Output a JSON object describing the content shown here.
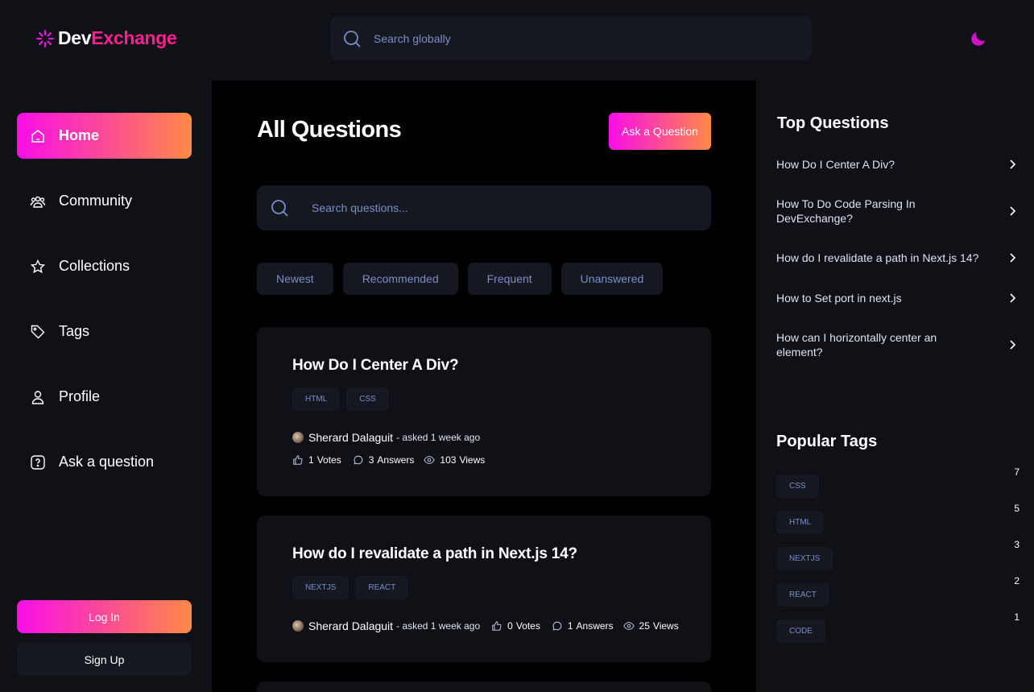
{
  "brand": {
    "part1": "Dev",
    "part2": "Exchange",
    "accent": "#ff1f8e"
  },
  "header": {
    "search_placeholder": "Search globally",
    "theme_icon": "moon-icon"
  },
  "sidebar": {
    "items": [
      {
        "label": "Home",
        "icon": "home-icon",
        "active": true
      },
      {
        "label": "Community",
        "icon": "users-icon",
        "active": false
      },
      {
        "label": "Collections",
        "icon": "star-icon",
        "active": false
      },
      {
        "label": "Tags",
        "icon": "tag-icon",
        "active": false
      },
      {
        "label": "Profile",
        "icon": "user-icon",
        "active": false
      },
      {
        "label": "Ask a question",
        "icon": "question-icon",
        "active": false
      }
    ],
    "login_label": "Log In",
    "signup_label": "Sign Up"
  },
  "main": {
    "title": "All Questions",
    "ask_button": "Ask a Question",
    "search_placeholder": "Search questions...",
    "filters": [
      "Newest",
      "Recommended",
      "Frequent",
      "Unanswered"
    ],
    "questions": [
      {
        "title": "How Do I Center A Div?",
        "tags": [
          "HTML",
          "CSS"
        ],
        "author": "Sherard Dalaguit",
        "asked": "- asked 1 week ago",
        "votes": "1",
        "votes_label": "Votes",
        "answers": "3",
        "answers_label": "Answers",
        "views": "103",
        "views_label": "Views"
      },
      {
        "title": "How do I revalidate a path in Next.js 14?",
        "tags": [
          "NEXTJS",
          "REACT"
        ],
        "author": "Sherard Dalaguit",
        "asked": "- asked 1 week ago",
        "votes": "0",
        "votes_label": "Votes",
        "answers": "1",
        "answers_label": "Answers",
        "views": "25",
        "views_label": "Views"
      }
    ]
  },
  "right": {
    "top_title": "Top Questions",
    "top_questions": [
      "How Do I Center A Div?",
      "How To Do Code Parsing In DevExchange?",
      "How do I revalidate a path in Next.js 14?",
      "How to Set port in next.js",
      "How can I horizontally center an element?"
    ],
    "tags_title": "Popular Tags",
    "popular_tags": [
      {
        "name": "CSS",
        "count": "7"
      },
      {
        "name": "HTML",
        "count": "5"
      },
      {
        "name": "NEXTJS",
        "count": "3"
      },
      {
        "name": "REACT",
        "count": "2"
      },
      {
        "name": "CODE",
        "count": "1"
      }
    ]
  },
  "colors": {
    "gradient_start": "#f90de8",
    "gradient_end": "#ff8a45",
    "panel": "#0f1117",
    "muted_text": "#7b8ec8"
  }
}
